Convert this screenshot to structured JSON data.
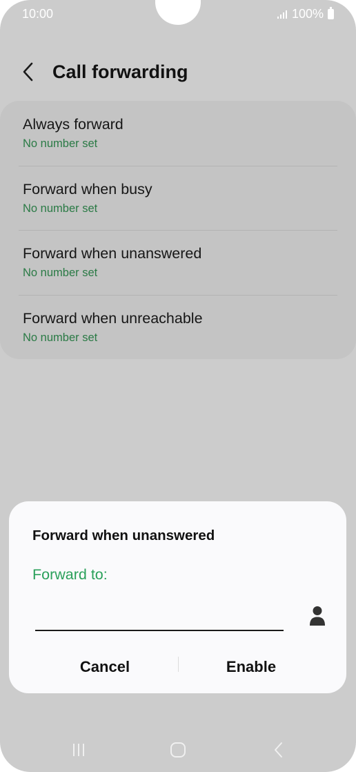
{
  "status_bar": {
    "time": "10:00",
    "battery": "100%"
  },
  "header": {
    "title": "Call forwarding"
  },
  "list": {
    "items": [
      {
        "title": "Always forward",
        "subtitle": "No number set"
      },
      {
        "title": "Forward when busy",
        "subtitle": "No number set"
      },
      {
        "title": "Forward when unanswered",
        "subtitle": "No number set"
      },
      {
        "title": "Forward when unreachable",
        "subtitle": "No number set"
      }
    ]
  },
  "dialog": {
    "title": "Forward when unanswered",
    "field_label": "Forward to:",
    "input_value": "",
    "cancel_label": "Cancel",
    "enable_label": "Enable"
  },
  "icons": {
    "back": "chevron-left-icon",
    "contact": "person-icon",
    "nav_recents": "recents-icon",
    "nav_home": "home-icon",
    "nav_back": "back-icon"
  },
  "colors": {
    "accent_green": "#2aa05a",
    "subtitle_green": "#2a7a45",
    "background": "#cccccc",
    "dialog_bg": "#fafafc"
  }
}
